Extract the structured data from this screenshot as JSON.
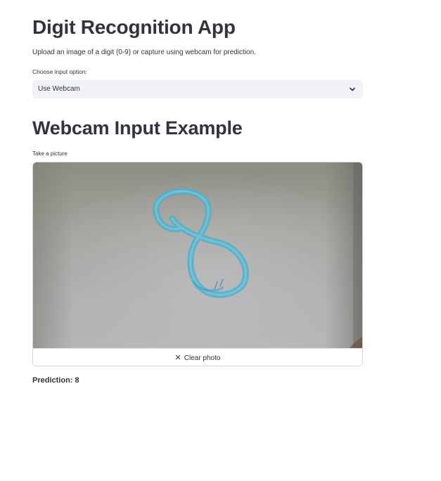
{
  "header": {
    "title": "Digit Recognition App",
    "description": "Upload an image of a digit (0-9) or capture using webcam for prediction."
  },
  "input_option": {
    "label": "Choose input option:",
    "selected": "Use Webcam",
    "icon": "chevron-down-icon"
  },
  "webcam": {
    "section_title": "Webcam Input Example",
    "camera_label": "Take a picture",
    "clear_button_label": "Clear photo",
    "clear_icon": "close-icon",
    "photo_subject": "8",
    "colors": {
      "ink": "#55b4cf",
      "wall_top": "#8f8f84",
      "wall_bottom": "#b4b3b5"
    }
  },
  "result": {
    "prediction_text": "Prediction: 8"
  }
}
